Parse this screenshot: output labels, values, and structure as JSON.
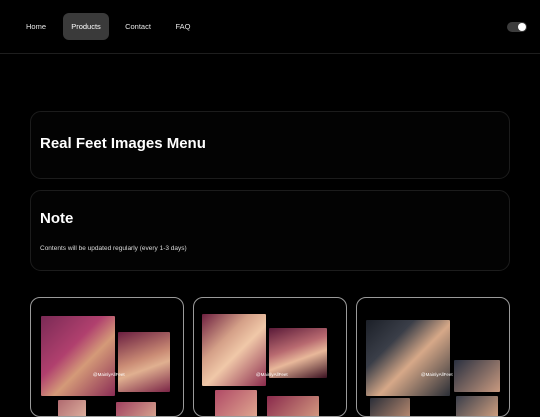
{
  "nav": {
    "home": "Home",
    "products": "Products",
    "contact": "Contact",
    "faq": "FAQ"
  },
  "menu_card": {
    "title": "Real Feet Images Menu"
  },
  "note_card": {
    "title": "Note",
    "text": "Contents will be updated regularly (every 1-3 days)"
  },
  "products": [
    {
      "watermark": "@MainlyAllFeet"
    },
    {
      "watermark": "@MainlyAllFeet"
    },
    {
      "watermark": "@MainlyAllFeet"
    }
  ],
  "theme": {
    "background": "#000000",
    "active_nav": "#3a3a3a",
    "card_border": "#1c1c1c",
    "product_border": "#9a9a9a"
  }
}
